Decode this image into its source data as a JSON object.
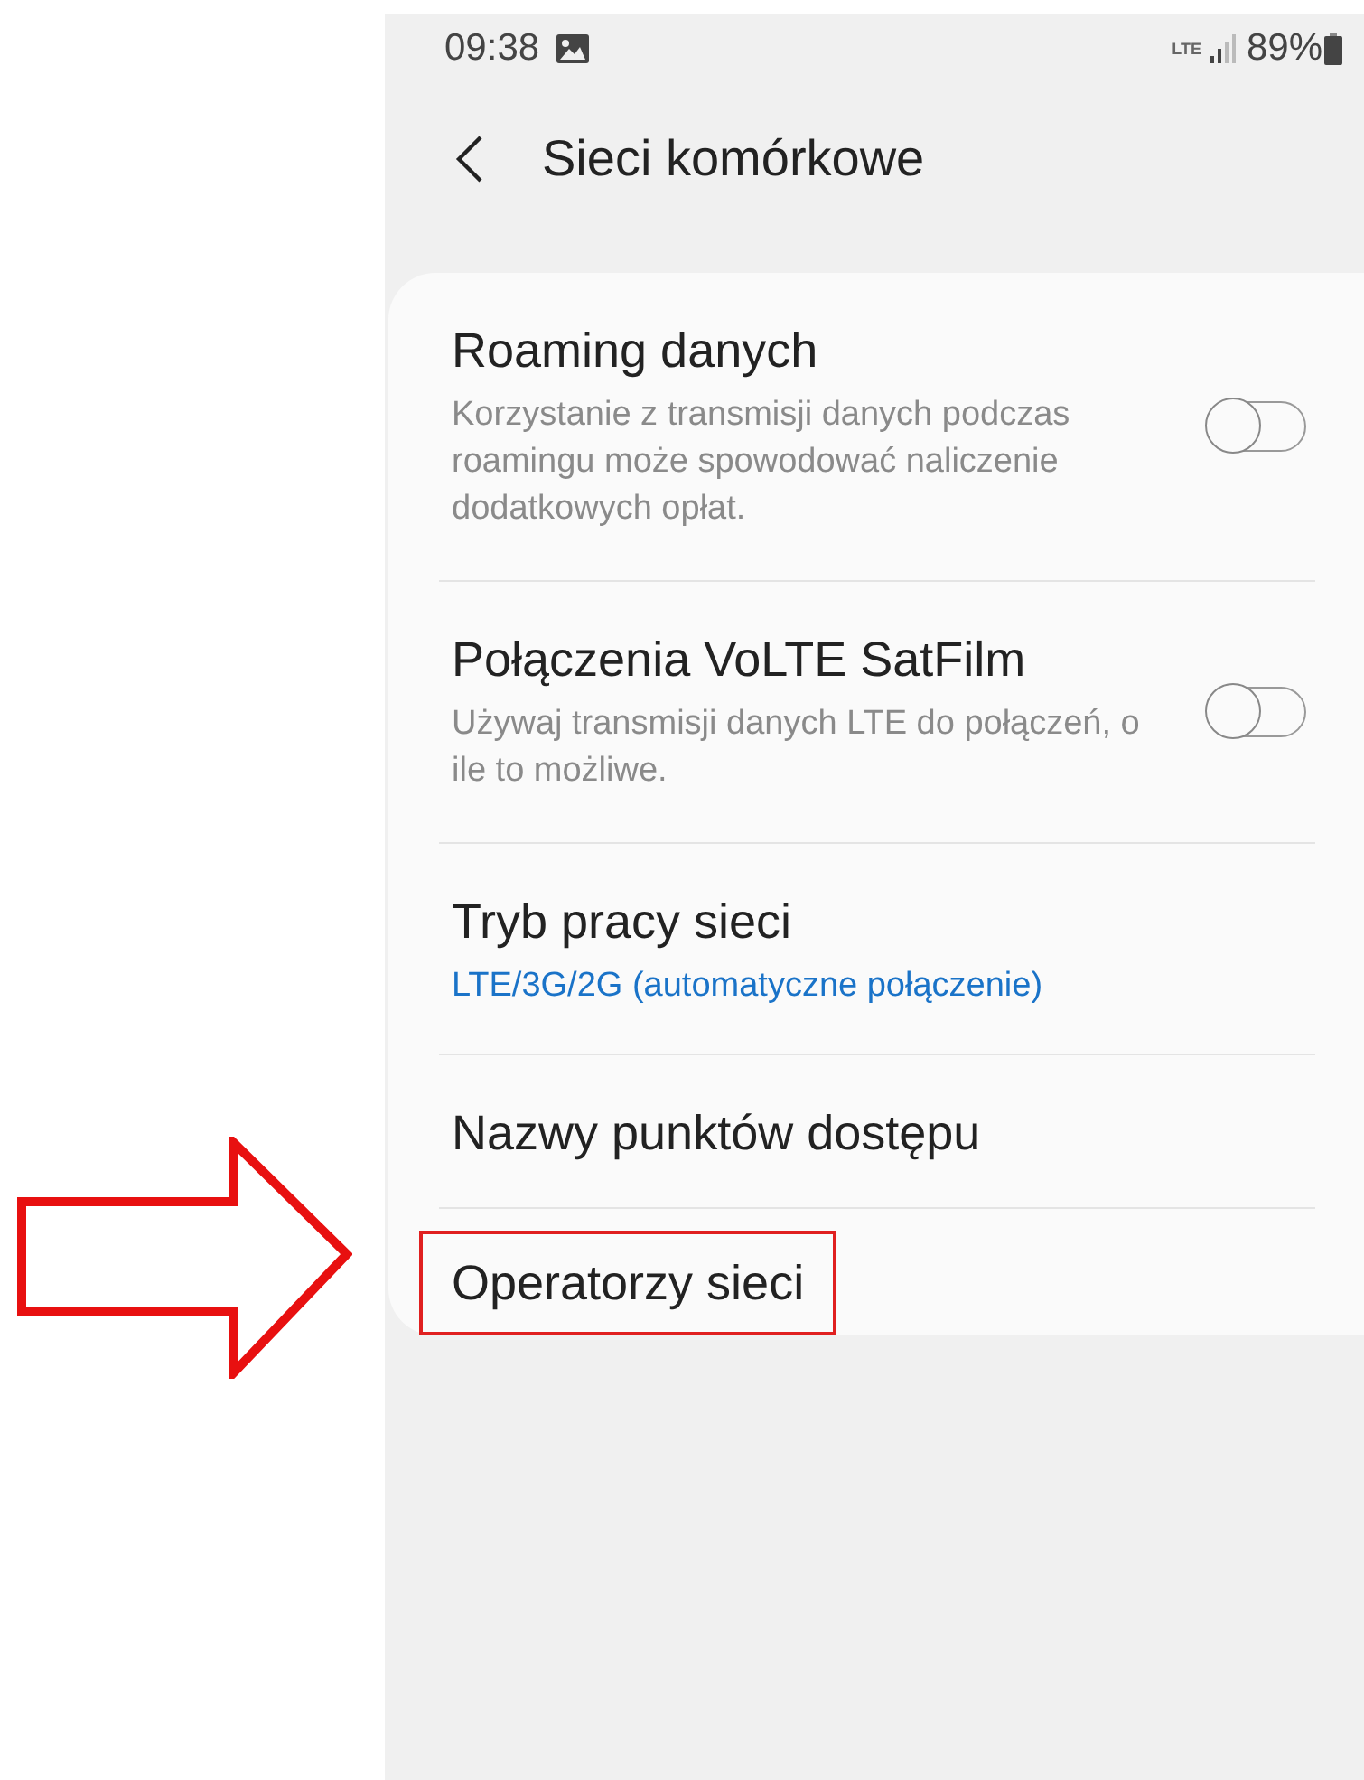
{
  "status_bar": {
    "time": "09:38",
    "network": "LTE",
    "battery": "89%"
  },
  "header": {
    "title": "Sieci komórkowe"
  },
  "items": [
    {
      "kind": "toggle",
      "title": "Roaming danych",
      "description": "Korzystanie z transmisji danych podczas roamingu może spowodować naliczenie dodatkowych opłat.",
      "on": false,
      "highlighted": false
    },
    {
      "kind": "toggle",
      "title": "Połączenia VoLTE SatFilm",
      "description": "Używaj transmisji danych LTE do połączeń, o ile to możliwe.",
      "on": false,
      "highlighted": false
    },
    {
      "kind": "value",
      "title": "Tryb pracy sieci",
      "value": "LTE/3G/2G (automatyczne połączenie)",
      "highlighted": false
    },
    {
      "kind": "plain",
      "title": "Nazwy punktów dostępu",
      "highlighted": false
    },
    {
      "kind": "plain",
      "title": "Operatorzy sieci",
      "highlighted": true
    }
  ]
}
